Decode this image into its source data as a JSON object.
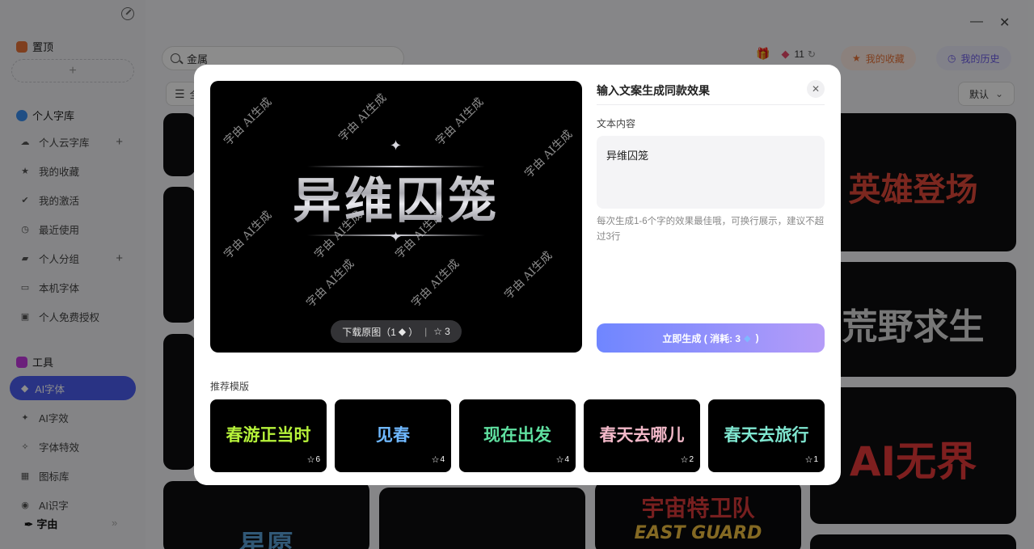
{
  "sidebar": {
    "pinned_label": "置顶",
    "add_symbol": "+",
    "personal_library_label": "个人字库",
    "items": [
      {
        "label": "个人云字库",
        "icon": "cloud-icon",
        "glyph": "☁",
        "has_add": true
      },
      {
        "label": "我的收藏",
        "icon": "star-icon",
        "glyph": "★",
        "has_add": false
      },
      {
        "label": "我的激活",
        "icon": "check-circle-icon",
        "glyph": "✔",
        "has_add": false
      },
      {
        "label": "最近使用",
        "icon": "clock-icon",
        "glyph": "◷",
        "has_add": false
      },
      {
        "label": "个人分组",
        "icon": "folder-icon",
        "glyph": "▰",
        "has_add": true
      },
      {
        "label": "本机字体",
        "icon": "monitor-icon",
        "glyph": "▭",
        "has_add": false
      },
      {
        "label": "个人免费授权",
        "icon": "license-icon",
        "glyph": "▣",
        "has_add": false
      }
    ],
    "tools_label": "工具",
    "tools": [
      {
        "label": "AI字体",
        "icon": "gem-icon",
        "glyph": "◆",
        "active": true
      },
      {
        "label": "AI字效",
        "icon": "sparkle-icon",
        "glyph": "✦",
        "active": false
      },
      {
        "label": "字体特效",
        "icon": "effect-icon",
        "glyph": "✧",
        "active": false
      },
      {
        "label": "图标库",
        "icon": "grid-icon",
        "glyph": "▦",
        "active": false
      },
      {
        "label": "AI识字",
        "icon": "ai-scan-icon",
        "glyph": "◉",
        "active": false
      }
    ],
    "brand": "字由",
    "collapse_glyph": "»"
  },
  "window": {
    "minimize": "—",
    "close": "✕"
  },
  "search": {
    "value": "金属"
  },
  "topbar": {
    "gem_count": "11",
    "favorites_label": "我的收藏",
    "history_label": "我的历史",
    "filter_label": "全",
    "sort_label": "默认"
  },
  "background_cards": [
    {
      "text": "英雄登场",
      "color": "#e0483a"
    },
    {
      "text": "荒野求生",
      "color": "#d9d9d9"
    },
    {
      "text": "AI无界",
      "color": "#e53a3a"
    },
    {
      "text": "宇宙特卫队",
      "color": "#d93a3a"
    },
    {
      "text": "EAST GUARD",
      "color": "#f0c040"
    },
    {
      "text": "星愿",
      "color": "#5aa0d8"
    }
  ],
  "modal": {
    "panel_title": "输入文案生成同款效果",
    "close_symbol": "✕",
    "field_label": "文本内容",
    "text_value": "异维囚笼",
    "hint": "每次生成1-6个字的效果最佳哦，可换行展示，建议不超过3行",
    "preview_text": "异维囚笼",
    "watermark": "字由 AI生成",
    "download_label": "下载原图（1",
    "download_close": "）",
    "divider": "|",
    "star_count": "3",
    "generate_label": "立即生成 ( 消耗: 3",
    "generate_close": ")",
    "recommend_title": "推荐模版",
    "templates": [
      {
        "text": "春游正当时",
        "count": "6",
        "color": "#b6f23a"
      },
      {
        "text": "见春",
        "count": "4",
        "color": "#6fb8ff"
      },
      {
        "text": "现在出发",
        "count": "4",
        "color": "#5fe0a0"
      },
      {
        "text": "春天去哪儿",
        "count": "2",
        "color": "#f2b8c8"
      },
      {
        "text": "春天去旅行",
        "count": "1",
        "color": "#7fe6d0"
      }
    ]
  }
}
